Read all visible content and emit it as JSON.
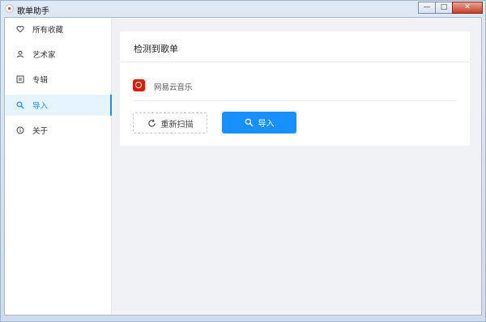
{
  "window": {
    "title": "歌单助手",
    "controls": {
      "minimize": "—",
      "maximize": "□",
      "close": "✕"
    }
  },
  "sidebar": {
    "items": [
      {
        "label": "所有收藏",
        "icon": "heart-icon",
        "active": false
      },
      {
        "label": "艺术家",
        "icon": "user-icon",
        "active": false
      },
      {
        "label": "专辑",
        "icon": "album-icon",
        "active": false
      },
      {
        "label": "导入",
        "icon": "search-icon",
        "active": true
      },
      {
        "label": "关于",
        "icon": "info-icon",
        "active": false
      }
    ]
  },
  "main": {
    "card_title": "检测到歌单",
    "source": {
      "name": "网易云音乐",
      "icon": "netease-music-icon"
    },
    "rescan_button": "重新扫描",
    "import_button": "导入"
  },
  "colors": {
    "accent": "#1890ff",
    "netease_red": "#d81e06"
  }
}
